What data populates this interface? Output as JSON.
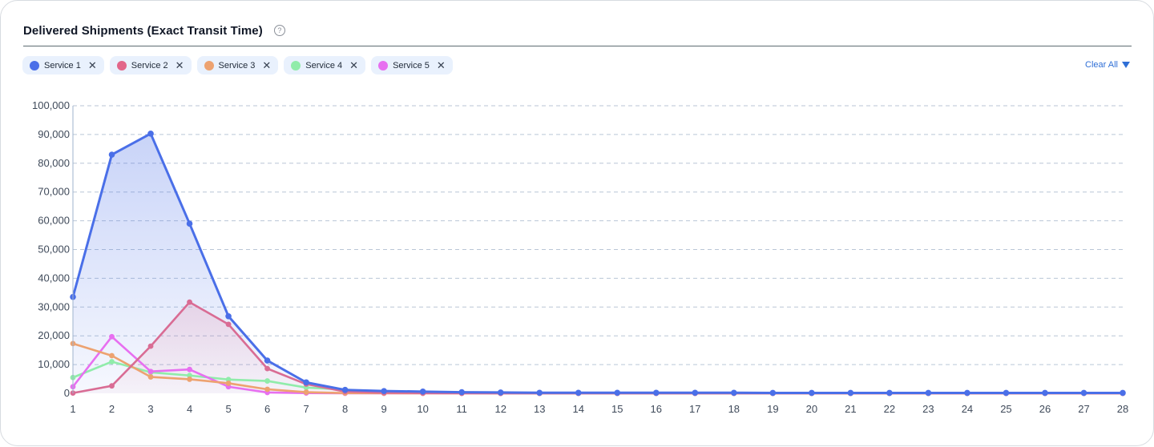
{
  "header": {
    "title": "Delivered Shipments (Exact Transit Time)",
    "help_icon": "question-circle-icon"
  },
  "filters": {
    "chips": [
      {
        "label": "Service 1",
        "color": "#4a6fe8"
      },
      {
        "label": "Service 2",
        "color": "#e2668a"
      },
      {
        "label": "Service 3",
        "color": "#eda270"
      },
      {
        "label": "Service 4",
        "color": "#90ecaa"
      },
      {
        "label": "Service 5",
        "color": "#e76ff0"
      }
    ],
    "clear_all": "Clear All"
  },
  "chart_data": {
    "type": "line",
    "x": [
      1,
      2,
      3,
      4,
      5,
      6,
      7,
      8,
      9,
      10,
      11,
      12,
      13,
      14,
      15,
      16,
      17,
      18,
      19,
      20,
      21,
      22,
      23,
      24,
      25,
      26,
      27,
      28
    ],
    "ylim": [
      0,
      100000
    ],
    "yticks": [
      "0",
      "10,000",
      "20,000",
      "30,000",
      "40,000",
      "50,000",
      "60,000",
      "70,000",
      "80,000",
      "90,000",
      "100,000"
    ],
    "grid": true,
    "series": [
      {
        "name": "Service 1",
        "color": "#4a6fe8",
        "fill": true,
        "values": [
          33500,
          83000,
          90300,
          59000,
          26800,
          11400,
          3800,
          1200,
          800,
          600,
          400,
          300,
          200,
          200,
          200,
          200,
          200,
          200,
          150,
          150,
          150,
          150,
          150,
          150,
          150,
          150,
          150,
          150
        ]
      },
      {
        "name": "Service 2",
        "color": "#d96c94",
        "fill": true,
        "values": [
          100,
          2600,
          16400,
          31700,
          24000,
          8600,
          3200,
          600,
          200,
          100,
          50,
          0,
          0,
          0,
          0,
          0,
          0,
          0,
          0,
          0,
          0,
          0,
          0,
          0,
          0,
          0,
          0,
          0
        ]
      },
      {
        "name": "Service 3",
        "color": "#eda270",
        "fill": false,
        "values": [
          17300,
          13100,
          5700,
          4900,
          3500,
          1400,
          400,
          100,
          50,
          0,
          0,
          0,
          0,
          0,
          0,
          0,
          0,
          0,
          0,
          0,
          0,
          0,
          0,
          0,
          0,
          0,
          0,
          0
        ]
      },
      {
        "name": "Service 4",
        "color": "#90ecaa",
        "fill": false,
        "values": [
          5500,
          11000,
          7300,
          6200,
          4800,
          4300,
          2000,
          1300,
          300,
          100,
          50,
          0,
          0,
          0,
          0,
          0,
          0,
          0,
          0,
          0,
          0,
          0,
          0,
          0,
          0,
          0,
          0,
          0
        ]
      },
      {
        "name": "Service 5",
        "color": "#e76ff0",
        "fill": false,
        "values": [
          2300,
          19700,
          7600,
          8300,
          2300,
          300,
          100,
          0,
          0,
          0,
          0,
          0,
          0,
          0,
          0,
          0,
          0,
          0,
          0,
          0,
          0,
          0,
          0,
          0,
          0,
          0,
          0,
          0
        ]
      }
    ]
  }
}
